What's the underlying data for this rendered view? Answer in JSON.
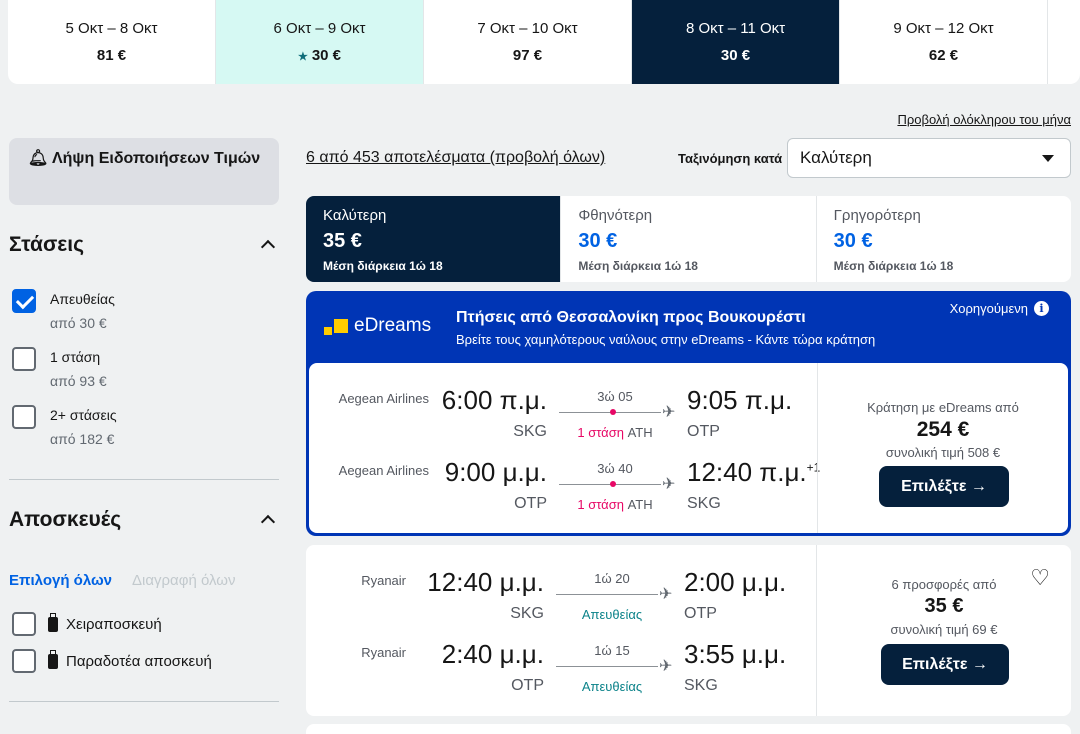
{
  "dates": [
    {
      "label": "5 Οκτ – 8 Οκτ",
      "price": "81 €"
    },
    {
      "label": "6 Οκτ – 9 Οκτ",
      "price": "30 €",
      "cheapest": true
    },
    {
      "label": "7 Οκτ – 10 Οκτ",
      "price": "97 €"
    },
    {
      "label": "8 Οκτ – 11 Οκτ",
      "price": "30 €",
      "selected": true
    },
    {
      "label": "9 Οκτ – 12 Οκτ",
      "price": "62 €"
    }
  ],
  "view_month": "Προβολή ολόκληρου του μήνα",
  "sidebar": {
    "alert_button": "Λήψη Ειδοποιήσεων Τιμών",
    "stops_title": "Στάσεις",
    "stops": [
      {
        "label": "Απευθείας",
        "sub": "από 30 €",
        "checked": true
      },
      {
        "label": "1 στάση",
        "sub": "από 93 €",
        "checked": false
      },
      {
        "label": "2+ στάσεις",
        "sub": "από 182 €",
        "checked": false
      }
    ],
    "bags_title": "Αποσκευές",
    "select_all": "Επιλογή όλων",
    "clear_all": "Διαγραφή όλων",
    "bags": [
      {
        "label": "Χειραποσκευή"
      },
      {
        "label": "Παραδοτέα αποσκευή"
      }
    ]
  },
  "results_text": "6 από 453 αποτελέσματα (προβολή όλων)",
  "sort": {
    "label": "Ταξινόμηση κατά",
    "value": "Καλύτερη"
  },
  "sort_tabs": [
    {
      "title": "Καλύτερη",
      "price": "35 €",
      "duration": "Μέση διάρκεια 1ώ 18",
      "active": true
    },
    {
      "title": "Φθηνότερη",
      "price": "30 €",
      "duration": "Μέση διάρκεια 1ώ 18"
    },
    {
      "title": "Γρηγορότερη",
      "price": "30 €",
      "duration": "Μέση διάρκεια 1ώ 18"
    }
  ],
  "ad": {
    "brand": "eDreams",
    "title": "Πτήσεις από Θεσσαλονίκη προς Βουκουρέστι",
    "subtitle": "Βρείτε τους χαμηλότερους ναύλους στην eDreams - Κάντε τώρα κράτηση",
    "sponsored": "Χορηγούμενη",
    "legs": [
      {
        "airline": "Aegean Airlines",
        "dep": "6:00 π.μ.",
        "dep_ap": "SKG",
        "dur": "3ώ 05",
        "stops": "1 στάση",
        "via": "ATH",
        "arr": "9:05 π.μ.",
        "arr_ap": "OTP",
        "plus": ""
      },
      {
        "airline": "Aegean Airlines",
        "dep": "9:00 μ.μ.",
        "dep_ap": "OTP",
        "dur": "3ώ 40",
        "stops": "1 στάση",
        "via": "ATH",
        "arr": "12:40 π.μ.",
        "arr_ap": "SKG",
        "plus": "+1"
      }
    ],
    "price_label": "Κράτηση με eDreams από",
    "price": "254 €",
    "total": "συνολική τιμή 508 €",
    "button": "Επιλέξτε →"
  },
  "flight": {
    "legs": [
      {
        "airline": "Ryanair",
        "dep": "12:40 μ.μ.",
        "dep_ap": "SKG",
        "dur": "1ώ 20",
        "stops": "Απευθείας",
        "arr": "2:00 μ.μ.",
        "arr_ap": "OTP"
      },
      {
        "airline": "Ryanair",
        "dep": "2:40 μ.μ.",
        "dep_ap": "OTP",
        "dur": "1ώ 15",
        "stops": "Απευθείας",
        "arr": "3:55 μ.μ.",
        "arr_ap": "SKG"
      }
    ],
    "offers": "6 προσφορές από",
    "price": "35 €",
    "total": "συνολική τιμή 69 €",
    "button": "Επιλέξτε →"
  }
}
